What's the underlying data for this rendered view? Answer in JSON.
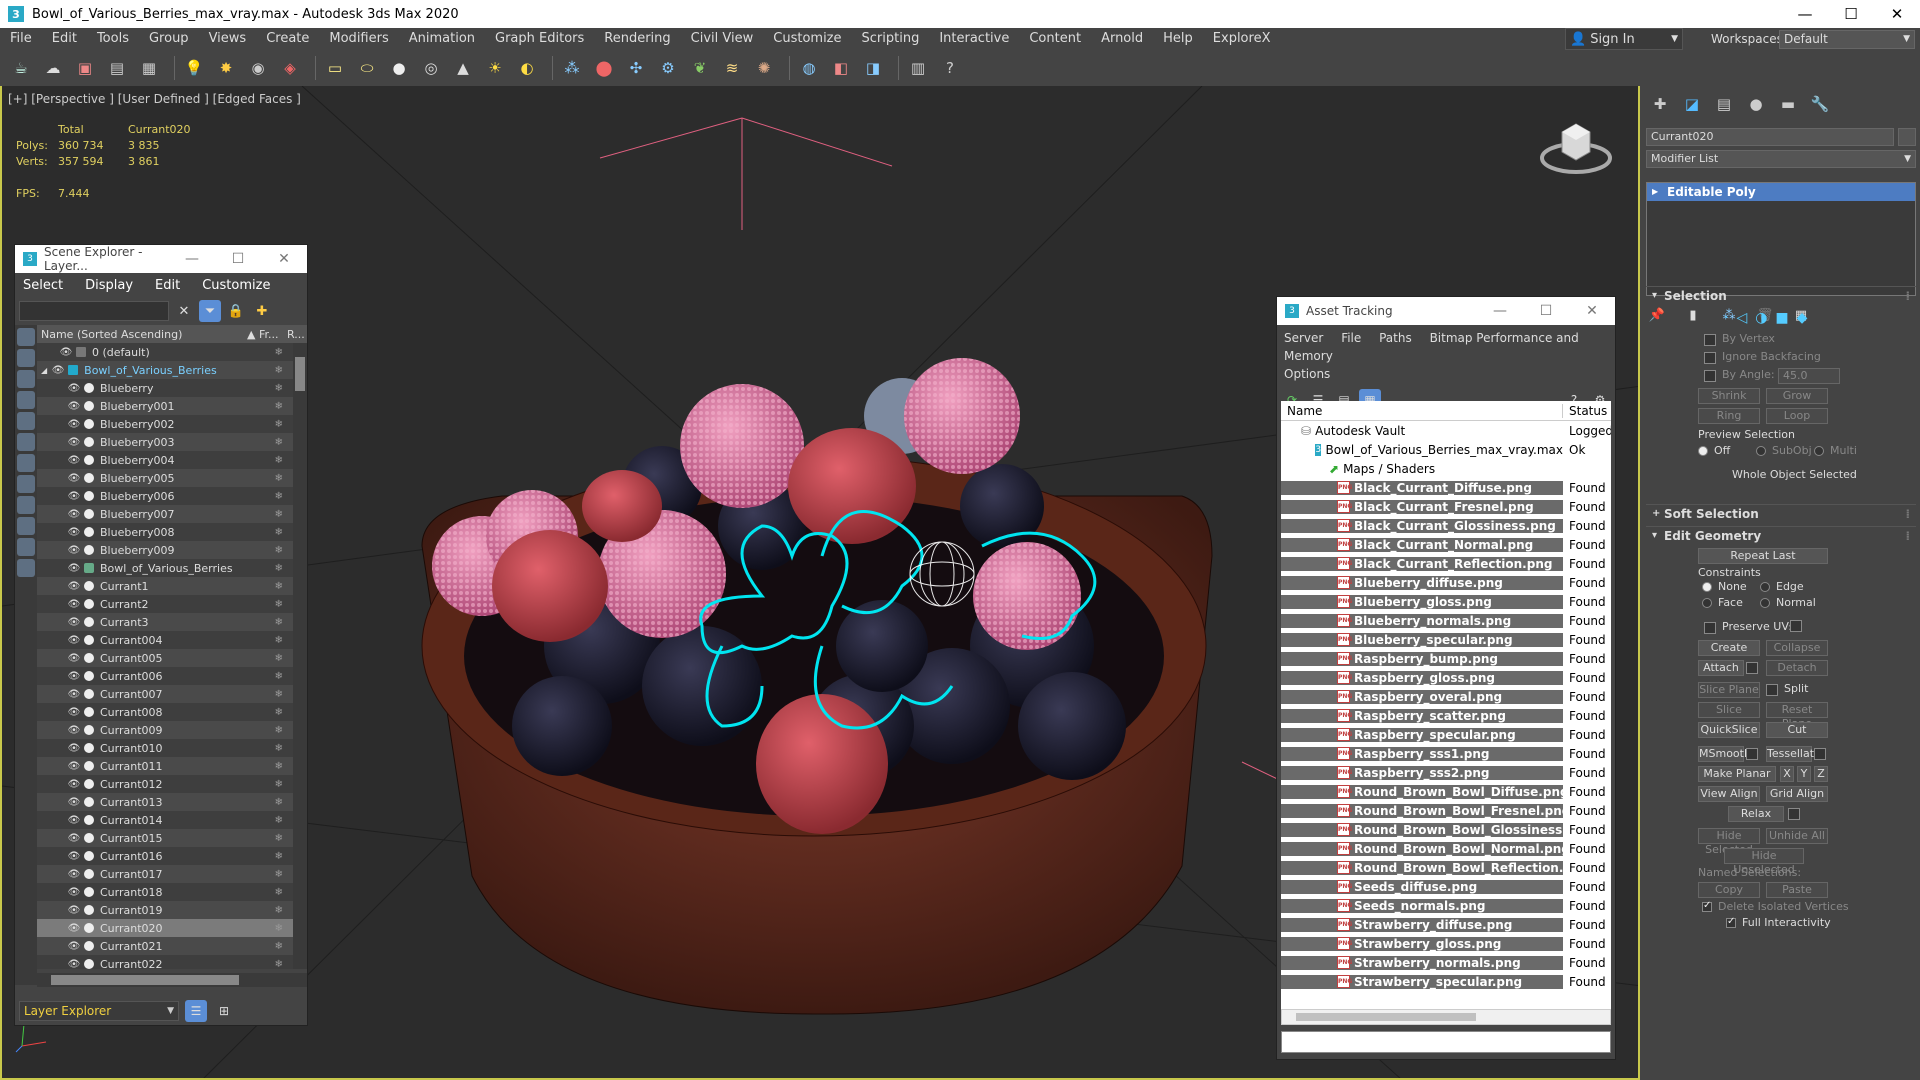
{
  "window": {
    "title": "Bowl_of_Various_Berries_max_vray.max - Autodesk 3ds Max 2020",
    "minimize": "—",
    "maximize": "☐",
    "close": "✕"
  },
  "menu": [
    "File",
    "Edit",
    "Tools",
    "Group",
    "Views",
    "Create",
    "Modifiers",
    "Animation",
    "Graph Editors",
    "Rendering",
    "Civil View",
    "Customize",
    "Scripting",
    "Interactive",
    "Content",
    "Arnold",
    "Help",
    "ExploreX"
  ],
  "signin": {
    "label": "Sign In"
  },
  "workspace": {
    "label": "Workspaces:",
    "value": "Default"
  },
  "viewport": {
    "label": "[+] [Perspective ] [User Defined ] [Edged Faces ]",
    "stats": {
      "h_total": "Total",
      "h_sel": "Currant020",
      "polys_label": "Polys:",
      "polys_total": "360 734",
      "polys_sel": "3 835",
      "verts_label": "Verts:",
      "verts_total": "357 594",
      "verts_sel": "3 861",
      "fps_label": "FPS:",
      "fps": "7.444"
    }
  },
  "scene_explorer": {
    "title": "Scene Explorer - Layer...",
    "menu": [
      "Select",
      "Display",
      "Edit",
      "Customize"
    ],
    "col_name": "Name (Sorted Ascending)",
    "col_fr": "▲ Fr...",
    "col_r": "R...",
    "rows": [
      {
        "name": "0 (default)",
        "indent": 1,
        "type": "layer"
      },
      {
        "name": "Bowl_of_Various_Berries",
        "indent": 0,
        "type": "layer-open"
      },
      {
        "name": "Blueberry",
        "indent": 2,
        "type": "obj"
      },
      {
        "name": "Blueberry001",
        "indent": 2,
        "type": "obj"
      },
      {
        "name": "Blueberry002",
        "indent": 2,
        "type": "obj"
      },
      {
        "name": "Blueberry003",
        "indent": 2,
        "type": "obj"
      },
      {
        "name": "Blueberry004",
        "indent": 2,
        "type": "obj"
      },
      {
        "name": "Blueberry005",
        "indent": 2,
        "type": "obj"
      },
      {
        "name": "Blueberry006",
        "indent": 2,
        "type": "obj"
      },
      {
        "name": "Blueberry007",
        "indent": 2,
        "type": "obj"
      },
      {
        "name": "Blueberry008",
        "indent": 2,
        "type": "obj"
      },
      {
        "name": "Blueberry009",
        "indent": 2,
        "type": "obj"
      },
      {
        "name": "Bowl_of_Various_Berries",
        "indent": 2,
        "type": "group"
      },
      {
        "name": "Currant1",
        "indent": 2,
        "type": "obj"
      },
      {
        "name": "Currant2",
        "indent": 2,
        "type": "obj"
      },
      {
        "name": "Currant3",
        "indent": 2,
        "type": "obj"
      },
      {
        "name": "Currant004",
        "indent": 2,
        "type": "obj"
      },
      {
        "name": "Currant005",
        "indent": 2,
        "type": "obj"
      },
      {
        "name": "Currant006",
        "indent": 2,
        "type": "obj"
      },
      {
        "name": "Currant007",
        "indent": 2,
        "type": "obj"
      },
      {
        "name": "Currant008",
        "indent": 2,
        "type": "obj"
      },
      {
        "name": "Currant009",
        "indent": 2,
        "type": "obj"
      },
      {
        "name": "Currant010",
        "indent": 2,
        "type": "obj"
      },
      {
        "name": "Currant011",
        "indent": 2,
        "type": "obj"
      },
      {
        "name": "Currant012",
        "indent": 2,
        "type": "obj"
      },
      {
        "name": "Currant013",
        "indent": 2,
        "type": "obj"
      },
      {
        "name": "Currant014",
        "indent": 2,
        "type": "obj"
      },
      {
        "name": "Currant015",
        "indent": 2,
        "type": "obj"
      },
      {
        "name": "Currant016",
        "indent": 2,
        "type": "obj"
      },
      {
        "name": "Currant017",
        "indent": 2,
        "type": "obj"
      },
      {
        "name": "Currant018",
        "indent": 2,
        "type": "obj"
      },
      {
        "name": "Currant019",
        "indent": 2,
        "type": "obj"
      },
      {
        "name": "Currant020",
        "indent": 2,
        "type": "obj",
        "selected": true
      },
      {
        "name": "Currant021",
        "indent": 2,
        "type": "obj"
      },
      {
        "name": "Currant022",
        "indent": 2,
        "type": "obj"
      }
    ],
    "footer": {
      "layer_explorer": "Layer Explorer"
    }
  },
  "asset_tracking": {
    "title": "Asset Tracking",
    "menu": [
      "Server",
      "File",
      "Paths",
      "Bitmap Performance and Memory",
      "Options"
    ],
    "col_name": "Name",
    "col_status": "Status",
    "rows": [
      {
        "name": "Autodesk Vault",
        "status": "Logged O",
        "level": 0,
        "icon": "vault"
      },
      {
        "name": "Bowl_of_Various_Berries_max_vray.max",
        "status": "Ok",
        "level": 1,
        "icon": "max"
      },
      {
        "name": "Maps / Shaders",
        "status": "",
        "level": 2,
        "icon": "maps"
      },
      {
        "name": "Black_Currant_Diffuse.png",
        "status": "Found",
        "level": 3,
        "icon": "png"
      },
      {
        "name": "Black_Currant_Fresnel.png",
        "status": "Found",
        "level": 3,
        "icon": "png"
      },
      {
        "name": "Black_Currant_Glossiness.png",
        "status": "Found",
        "level": 3,
        "icon": "png"
      },
      {
        "name": "Black_Currant_Normal.png",
        "status": "Found",
        "level": 3,
        "icon": "png"
      },
      {
        "name": "Black_Currant_Reflection.png",
        "status": "Found",
        "level": 3,
        "icon": "png"
      },
      {
        "name": "Blueberry_diffuse.png",
        "status": "Found",
        "level": 3,
        "icon": "png"
      },
      {
        "name": "Blueberry_gloss.png",
        "status": "Found",
        "level": 3,
        "icon": "png"
      },
      {
        "name": "Blueberry_normals.png",
        "status": "Found",
        "level": 3,
        "icon": "png"
      },
      {
        "name": "Blueberry_specular.png",
        "status": "Found",
        "level": 3,
        "icon": "png"
      },
      {
        "name": "Raspberry_bump.png",
        "status": "Found",
        "level": 3,
        "icon": "png"
      },
      {
        "name": "Raspberry_gloss.png",
        "status": "Found",
        "level": 3,
        "icon": "png"
      },
      {
        "name": "Raspberry_overal.png",
        "status": "Found",
        "level": 3,
        "icon": "png"
      },
      {
        "name": "Raspberry_scatter.png",
        "status": "Found",
        "level": 3,
        "icon": "png"
      },
      {
        "name": "Raspberry_specular.png",
        "status": "Found",
        "level": 3,
        "icon": "png"
      },
      {
        "name": "Raspberry_sss1.png",
        "status": "Found",
        "level": 3,
        "icon": "png"
      },
      {
        "name": "Raspberry_sss2.png",
        "status": "Found",
        "level": 3,
        "icon": "png"
      },
      {
        "name": "Round_Brown_Bowl_Diffuse.png",
        "status": "Found",
        "level": 3,
        "icon": "png"
      },
      {
        "name": "Round_Brown_Bowl_Fresnel.png",
        "status": "Found",
        "level": 3,
        "icon": "png"
      },
      {
        "name": "Round_Brown_Bowl_Glossiness.png",
        "status": "Found",
        "level": 3,
        "icon": "png"
      },
      {
        "name": "Round_Brown_Bowl_Normal.png",
        "status": "Found",
        "level": 3,
        "icon": "png"
      },
      {
        "name": "Round_Brown_Bowl_Reflection.png",
        "status": "Found",
        "level": 3,
        "icon": "png"
      },
      {
        "name": "Seeds_diffuse.png",
        "status": "Found",
        "level": 3,
        "icon": "png"
      },
      {
        "name": "Seeds_normals.png",
        "status": "Found",
        "level": 3,
        "icon": "png"
      },
      {
        "name": "Strawberry_diffuse.png",
        "status": "Found",
        "level": 3,
        "icon": "png"
      },
      {
        "name": "Strawberry_gloss.png",
        "status": "Found",
        "level": 3,
        "icon": "png"
      },
      {
        "name": "Strawberry_normals.png",
        "status": "Found",
        "level": 3,
        "icon": "png"
      },
      {
        "name": "Strawberry_specular.png",
        "status": "Found",
        "level": 3,
        "icon": "png"
      }
    ]
  },
  "command_panel": {
    "object_name": "Currant020",
    "modifier_list": "Modifier List",
    "stack_item": "Editable Poly",
    "selection": {
      "title": "Selection",
      "by_vertex": "By Vertex",
      "ignore_backfacing": "Ignore Backfacing",
      "by_angle": "By Angle:",
      "angle_value": "45.0",
      "shrink": "Shrink",
      "grow": "Grow",
      "ring": "Ring",
      "loop": "Loop",
      "preview_selection": "Preview Selection",
      "off": "Off",
      "subobj": "SubObj",
      "multi": "Multi",
      "whole_object": "Whole Object Selected"
    },
    "soft_selection": {
      "title": "Soft Selection"
    },
    "edit_geometry": {
      "title": "Edit Geometry",
      "repeat_last": "Repeat Last",
      "constraints": "Constraints",
      "none": "None",
      "edge": "Edge",
      "face": "Face",
      "normal": "Normal",
      "preserve_uvs": "Preserve UVs",
      "create": "Create",
      "collapse": "Collapse",
      "attach": "Attach",
      "detach": "Detach",
      "slice_plane": "Slice Plane",
      "split": "Split",
      "slice": "Slice",
      "reset_plane": "Reset Plane",
      "quickslice": "QuickSlice",
      "cut": "Cut",
      "msmooth": "MSmooth",
      "tessellate": "Tessellate",
      "make_planar": "Make Planar",
      "x": "X",
      "y": "Y",
      "z": "Z",
      "view_align": "View Align",
      "grid_align": "Grid Align",
      "relax": "Relax",
      "hide_selected": "Hide Selected",
      "unhide_all": "Unhide All",
      "hide_unselected": "Hide Unselected",
      "named_selections": "Named Selections:",
      "copy": "Copy",
      "paste": "Paste",
      "delete_isolated": "Delete Isolated Vertices",
      "full_interactivity": "Full Interactivity"
    }
  },
  "colors": {
    "accent": "#5b8ed6",
    "stats": "#e0d060",
    "selection": "#00e5f0",
    "raspberry": "#e07aa0",
    "bowl": "#6b2f22"
  }
}
